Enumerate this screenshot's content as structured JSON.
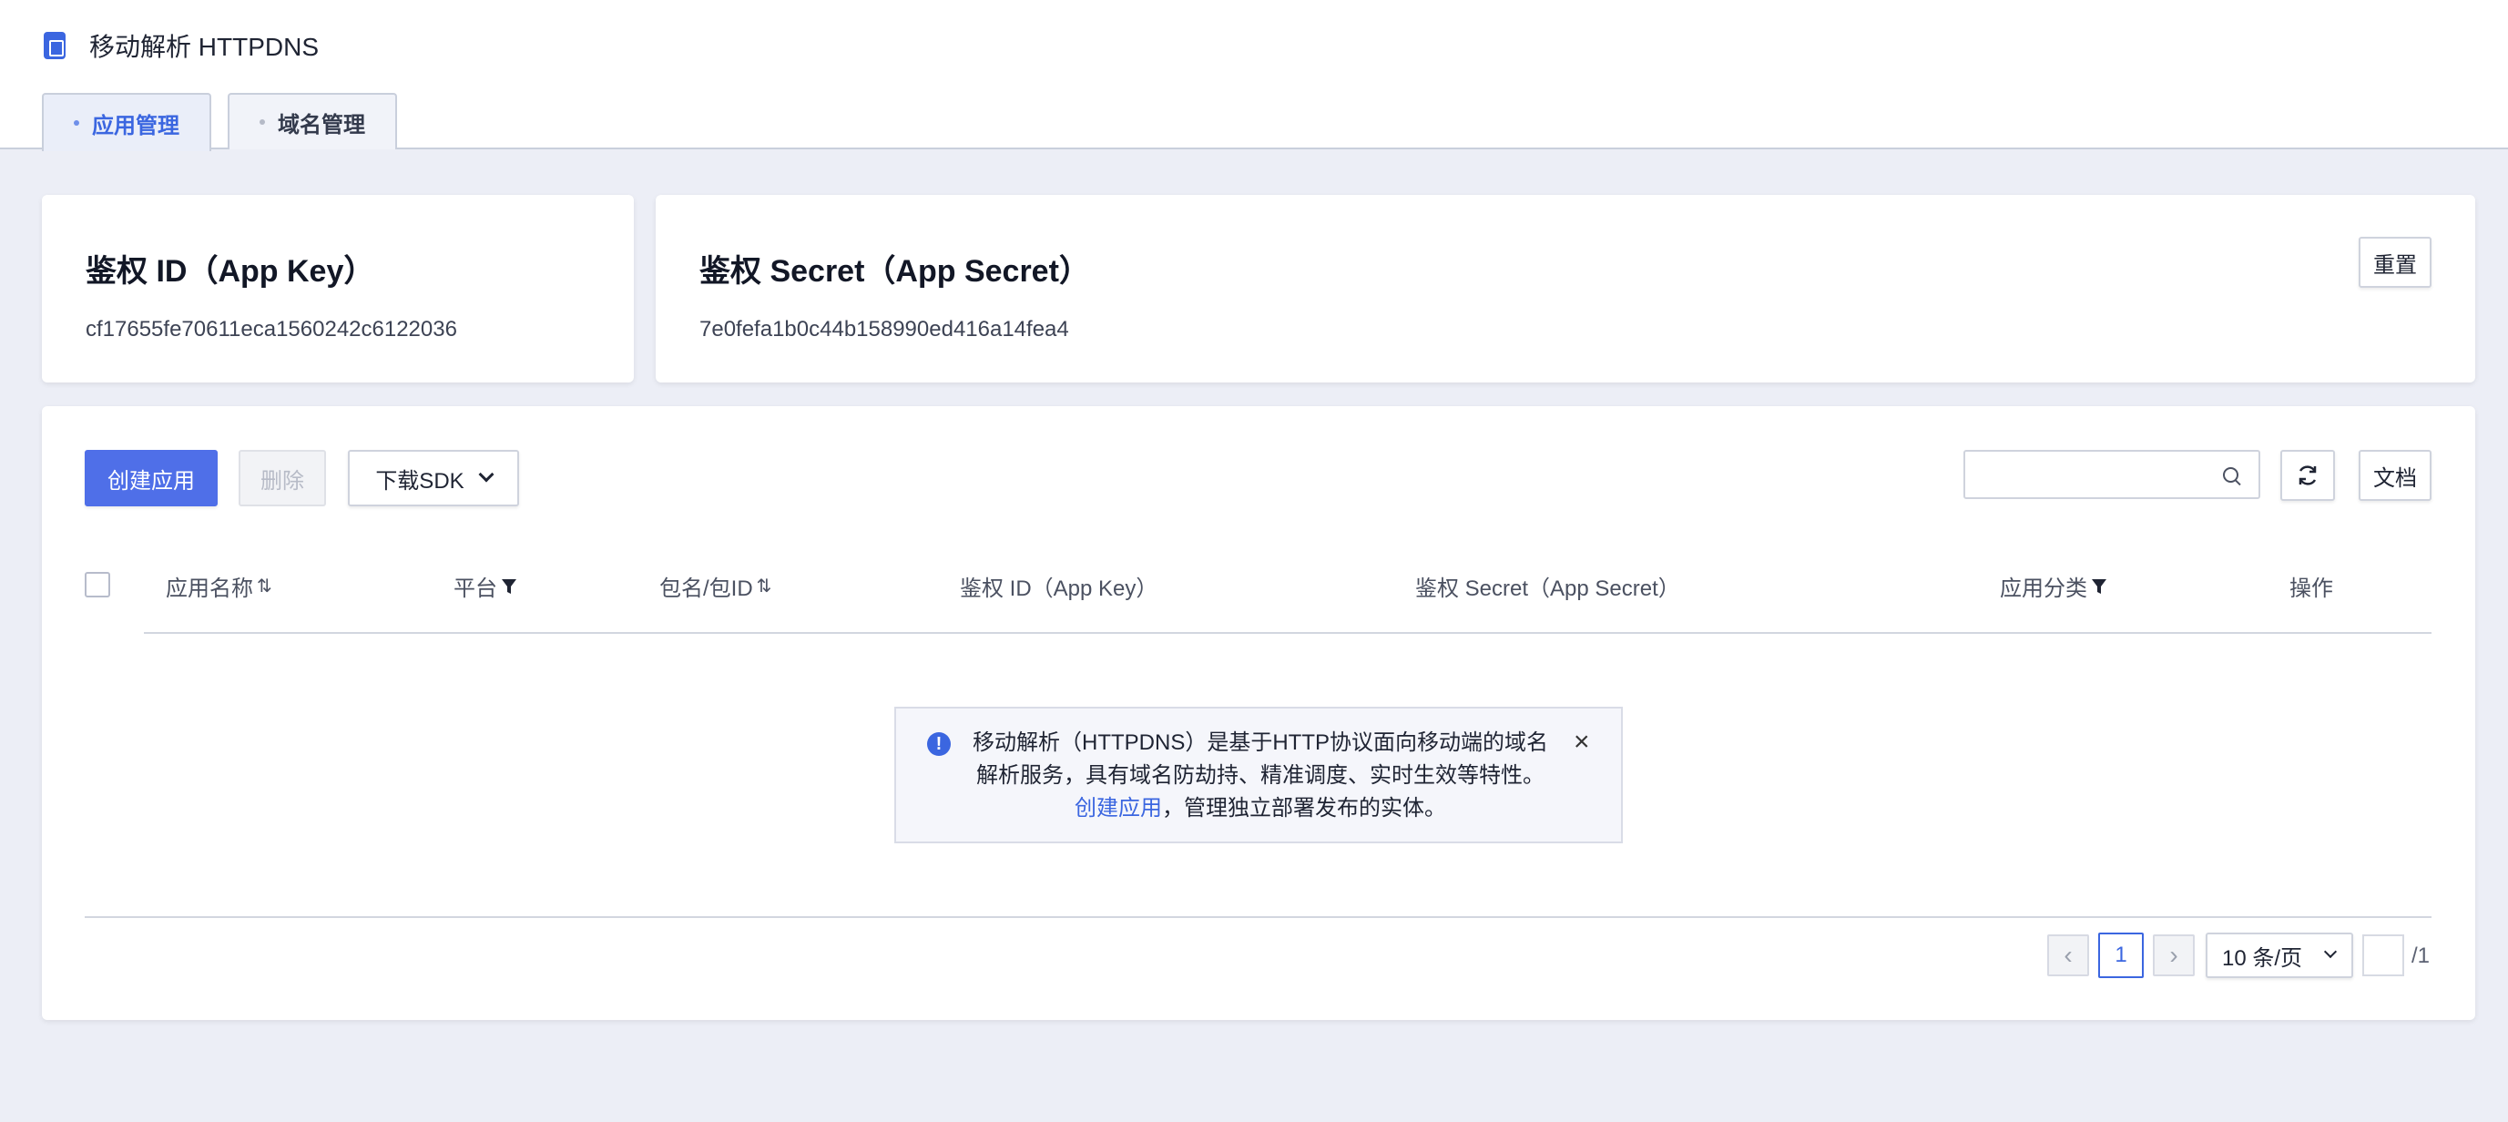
{
  "header": {
    "title": "移动解析 HTTPDNS",
    "tabs": [
      {
        "label": "应用管理",
        "active": true
      },
      {
        "label": "域名管理",
        "active": false
      }
    ]
  },
  "key_card": {
    "title": "鉴权 ID（App Key）",
    "value": "cf17655fe70611eca1560242c6122036"
  },
  "secret_card": {
    "title": "鉴权 Secret（App Secret）",
    "value": "7e0fefa1b0c44b158990ed416a14fea4",
    "reset_label": "重置"
  },
  "toolbar": {
    "create_label": "创建应用",
    "delete_label": "删除",
    "download_label": "下载SDK",
    "search_placeholder": "",
    "docs_label": "文档"
  },
  "table": {
    "columns": [
      "应用名称",
      "平台",
      "包名/包ID",
      "鉴权 ID（App Key）",
      "鉴权 Secret（App Secret）",
      "应用分类",
      "操作"
    ]
  },
  "empty_notice": {
    "line1": "移动解析（HTTPDNS）是基于HTTP协议面向移动端的域名",
    "line2": "解析服务，具有域名防劫持、精准调度、实时生效等特性。",
    "link": "创建应用",
    "suffix": "，管理独立部署发布的实体。"
  },
  "pagination": {
    "current_page": "1",
    "page_size": "10 条/页",
    "total": "/1"
  },
  "colors": {
    "primary": "#4f6fe8",
    "link": "#3b66e0"
  }
}
